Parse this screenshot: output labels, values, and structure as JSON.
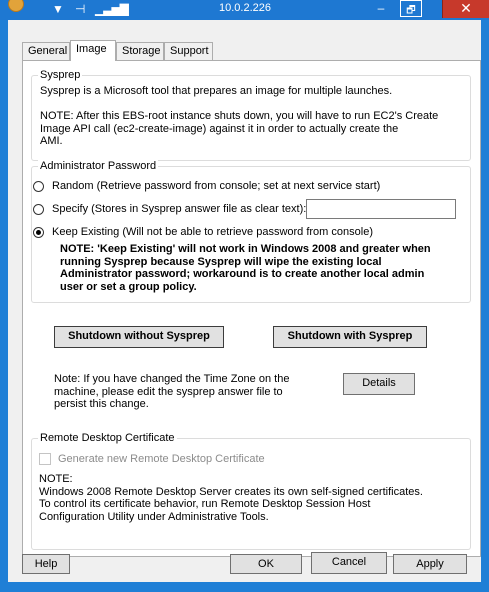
{
  "window": {
    "title": "10.0.2.226",
    "close_glyph": "✕",
    "minimize_glyph": "–",
    "restore_glyph": "🗗",
    "toolbar_icons": [
      "chevron-down-icon",
      "pin-icon",
      "signal-icon"
    ]
  },
  "tabs": [
    {
      "label": "General"
    },
    {
      "label": "Image"
    },
    {
      "label": "Storage"
    },
    {
      "label": "Support"
    }
  ],
  "sysprep": {
    "title": "Sysprep",
    "description": "Sysprep is a Microsoft tool that prepares an image for multiple launches.",
    "note": "NOTE: After this EBS-root instance shuts down, you will have to run EC2's Create\nImage API call (ec2-create-image) against it in order to actually create the\nAMI."
  },
  "admin_password": {
    "title": "Administrator Password",
    "options": [
      {
        "label": "Random (Retrieve password from console; set at next service start)",
        "checked": false
      },
      {
        "label": "Specify (Stores in Sysprep answer file as clear text):",
        "checked": false
      },
      {
        "label": "Keep Existing (Will not be able to retrieve password from console)",
        "checked": true
      }
    ],
    "specify_value": "",
    "warning": "NOTE: 'Keep Existing' will not work in Windows 2008 and greater when\nrunning Sysprep because Sysprep will wipe the existing local\nAdministrator password; workaround is to create another local admin\nuser or set a group policy."
  },
  "actions": {
    "shutdown_without": "Shutdown without Sysprep",
    "shutdown_with": "Shutdown with Sysprep",
    "timezone_note": "Note: If you have changed the Time Zone on the\nmachine, please edit the sysprep answer file to\npersist this change.",
    "details": "Details"
  },
  "rdp_cert": {
    "title": "Remote Desktop Certificate",
    "checkbox_label": "Generate new Remote Desktop Certificate",
    "checked": false,
    "note": "NOTE:\nWindows 2008 Remote Desktop Server creates its own self-signed certificates.\nTo control its certificate behavior, run Remote Desktop Session Host\nConfiguration Utility under Administrative Tools."
  },
  "footer": {
    "help": "Help",
    "ok": "OK",
    "cancel": "Cancel",
    "apply": "Apply"
  },
  "colors": {
    "titlebar": "#1e78d2",
    "close_button": "#c7392b",
    "dialog_bg": "#f0f0f0"
  }
}
